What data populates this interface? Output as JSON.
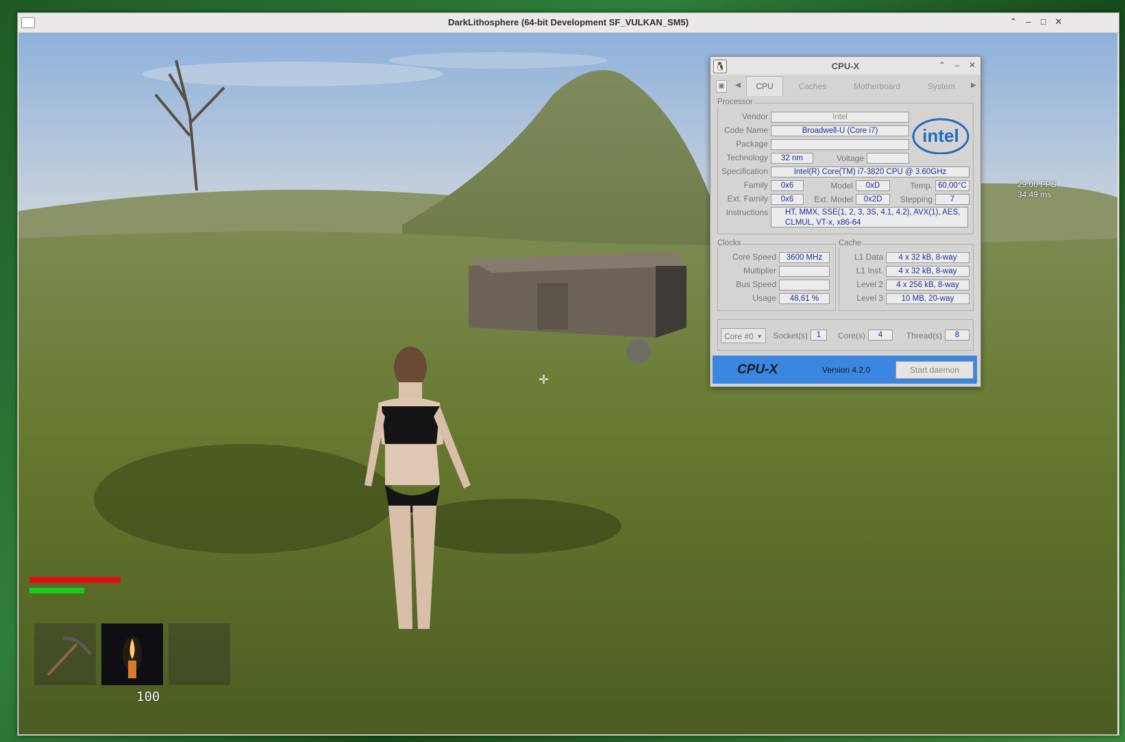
{
  "game_window": {
    "title": "DarkLithosphere (64-bit Development SF_VULKAN_SM5)"
  },
  "hud": {
    "fps": "29.00 FPS",
    "frame_time": "34.49 ms",
    "health_fraction": 1.0,
    "stamina_fraction": 0.6,
    "slot_count": "100",
    "slots": [
      "pickaxe-icon",
      "candle-icon",
      "empty"
    ]
  },
  "cpux": {
    "title": "CPU-X",
    "tabs": [
      "CPU",
      "Caches",
      "Motherboard",
      "System"
    ],
    "active_tab": "CPU",
    "processor": {
      "group_label": "Processor",
      "vendor_label": "Vendor",
      "vendor": "Intel",
      "code_name_label": "Code Name",
      "code_name": "Broadwell-U (Core i7)",
      "package_label": "Package",
      "package": "",
      "technology_label": "Technology",
      "technology": "32 nm",
      "voltage_label": "Voltage",
      "voltage": "",
      "specification_label": "Specification",
      "specification": "Intel(R) Core(TM) i7-3820 CPU @ 3.60GHz",
      "family_label": "Family",
      "family": "0x6",
      "model_label": "Model",
      "model": "0xD",
      "temp_label": "Temp.",
      "temp": "60,00°C",
      "ext_family_label": "Ext. Family",
      "ext_family": "0x6",
      "ext_model_label": "Ext. Model",
      "ext_model": "0x2D",
      "stepping_label": "Stepping",
      "stepping": "7",
      "instructions_label": "Instructions",
      "instructions": "HT, MMX, SSE(1, 2, 3, 3S, 4.1, 4.2), AVX(1), AES, CLMUL, VT-x, x86-64",
      "logo_text": "intel"
    },
    "clocks": {
      "group_label": "Clocks",
      "core_speed_label": "Core Speed",
      "core_speed": "3600 MHz",
      "multiplier_label": "Multiplier",
      "multiplier": "",
      "bus_speed_label": "Bus Speed",
      "bus_speed": "",
      "usage_label": "Usage",
      "usage": "48,61 %"
    },
    "cache": {
      "group_label": "Cache",
      "l1_data_label": "L1 Data",
      "l1_data": "4 x 32 kB, 8-way",
      "l1_inst_label": "L1 Inst.",
      "l1_inst": "4 x 32 kB, 8-way",
      "level2_label": "Level 2",
      "level2": "4 x 256 kB, 8-way",
      "level3_label": "Level 3",
      "level3": "10 MB, 20-way"
    },
    "selection": {
      "core_select": "Core #0",
      "sockets_label": "Socket(s)",
      "sockets": "1",
      "cores_label": "Core(s)",
      "cores": "4",
      "threads_label": "Thread(s)",
      "threads": "8"
    },
    "footer": {
      "brand": "CPU-X",
      "version": "Version 4.2.0",
      "daemon_button": "Start daemon"
    },
    "colors": {
      "footer_blue": "#3a86e1",
      "value_text": "#1a2f9a",
      "intel_blue": "#1e6bc1"
    }
  }
}
